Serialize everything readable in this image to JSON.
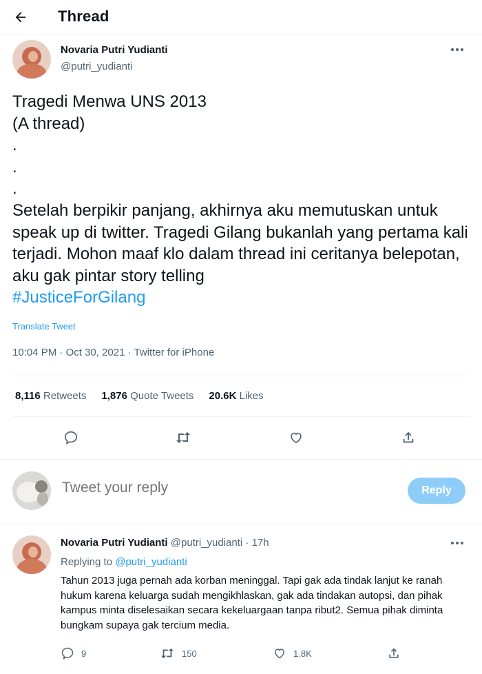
{
  "header": {
    "title": "Thread"
  },
  "tweet": {
    "author_name": "Novaria Putri Yudianti",
    "author_handle": "@putri_yudianti",
    "text": "Tragedi Menwa UNS 2013\n(A thread)\n.\n.\n.\nSetelah berpikir panjang, akhirnya aku memutuskan untuk speak up di twitter. Tragedi Gilang bukanlah yang pertama kali terjadi. Mohon maaf klo dalam thread ini ceritanya belepotan, aku gak pintar story telling",
    "hashtag": "#JusticeForGilang",
    "translate_label": "Translate Tweet",
    "time": "10:04 PM",
    "date": "Oct 30, 2021",
    "source": "Twitter for iPhone",
    "separator": " · ",
    "stats": {
      "retweets_count": "8,116",
      "retweets_label": "Retweets",
      "quotes_count": "1,876",
      "quotes_label": "Quote Tweets",
      "likes_count": "20.6K",
      "likes_label": "Likes"
    }
  },
  "compose": {
    "placeholder": "Tweet your reply",
    "button_label": "Reply"
  },
  "reply": {
    "author_name": "Novaria Putri Yudianti",
    "author_handle": "@putri_yudianti",
    "time": "17h",
    "separator": " · ",
    "replying_to_label": "Replying to",
    "replying_to_handle": "@putri_yudianti",
    "text": "Tahun 2013 juga pernah ada korban meninggal. Tapi gak ada tindak lanjut ke ranah hukum karena keluarga sudah mengikhlaskan, gak ada tindakan autopsi, dan pihak kampus minta diselesaikan secara kekeluargaan tanpa ribut2. Semua pihak diminta bungkam supaya gak tercium media.",
    "replies": "9",
    "retweets": "150",
    "likes": "1.8K"
  },
  "colors": {
    "accent": "#1d9bf0",
    "reply_button": "#8ecdf8",
    "secondary_text": "#536471",
    "divider": "#eff3f4"
  },
  "icons": [
    "back-arrow-icon",
    "more-icon",
    "reply-icon",
    "retweet-icon",
    "like-icon",
    "share-icon"
  ]
}
